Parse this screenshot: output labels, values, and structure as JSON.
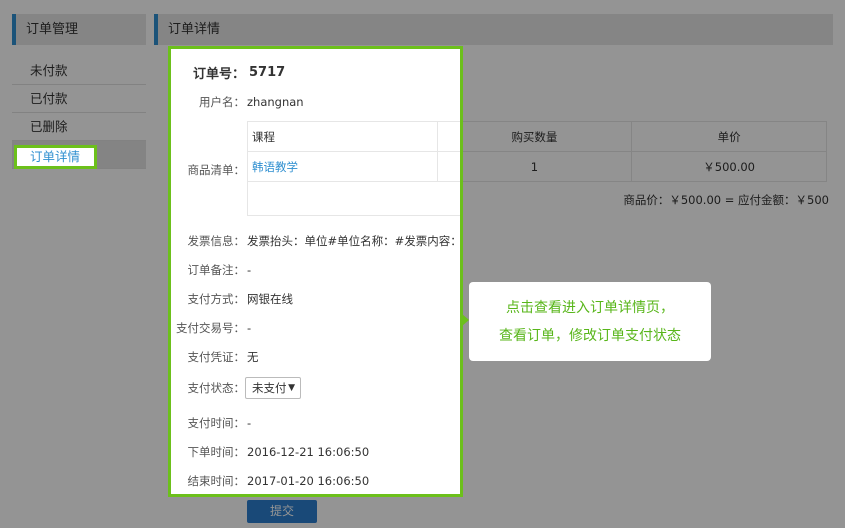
{
  "sidebar": {
    "title": "订单管理",
    "items": [
      {
        "label": "未付款"
      },
      {
        "label": "已付款"
      },
      {
        "label": "已删除"
      },
      {
        "label": "订单详情"
      }
    ]
  },
  "main": {
    "title": "订单详情",
    "order_no_label": "订单号：",
    "order_no": "5717",
    "username_label": "用户名：",
    "username": "zhangnan",
    "goods_label": "商品清单：",
    "goods_headers": [
      "课程",
      "购买数量",
      "单价"
    ],
    "goods_rows": [
      {
        "course": "韩语教学",
        "qty": "1",
        "price": "￥500.00"
      }
    ],
    "price_summary": "商品价：￥500.00 = 应付金额：￥500",
    "invoice_label": "发票信息：",
    "invoice": "发票抬头：单位#单位名称：#发票内容：明细",
    "remark_label": "订单备注：",
    "remark": "-",
    "pay_method_label": "支付方式：",
    "pay_method": "网银在线",
    "trade_no_label": "支付交易号：",
    "trade_no": "-",
    "voucher_label": "支付凭证：",
    "voucher": "无",
    "pay_status_label": "支付状态：",
    "pay_status": "未支付",
    "pay_time_label": "支付时间：",
    "pay_time": "-",
    "order_time_label": "下单时间：",
    "order_time": "2016-12-21 16:06:50",
    "end_time_label": "结束时间：",
    "end_time": "2017-01-20 16:06:50",
    "submit_label": "提交"
  },
  "callout": {
    "line1": "点击查看进入订单详情页，",
    "line2": "查看订单，修改订单支付状态"
  },
  "colors": {
    "accent_blue": "#2f8fd0",
    "highlight_green": "#6cc01b",
    "callout_text": "#58b61a",
    "button_blue": "#2c7fcf"
  }
}
